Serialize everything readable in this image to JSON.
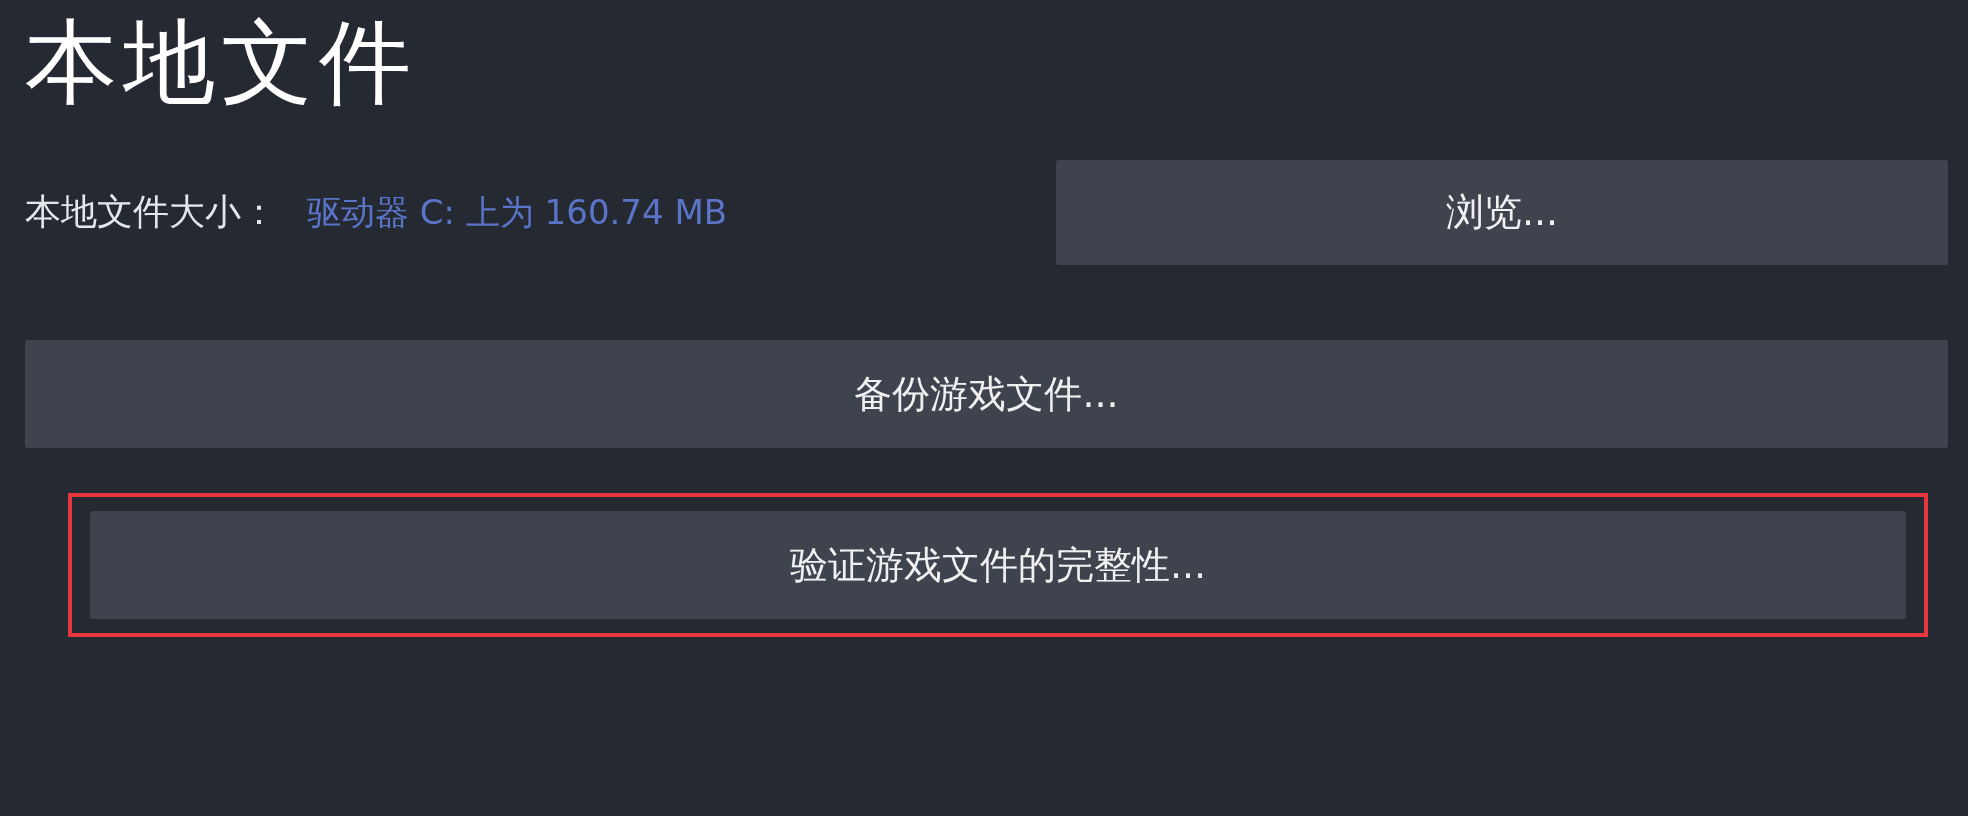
{
  "title": "本地文件",
  "size_row": {
    "label": "本地文件大小：",
    "value": "驱动器 C: 上为 160.74 MB",
    "button": "浏览..."
  },
  "buttons": [
    {
      "label": "备份游戏文件...",
      "highlighted": false
    },
    {
      "label": "验证游戏文件的完整性...",
      "highlighted": true
    }
  ]
}
